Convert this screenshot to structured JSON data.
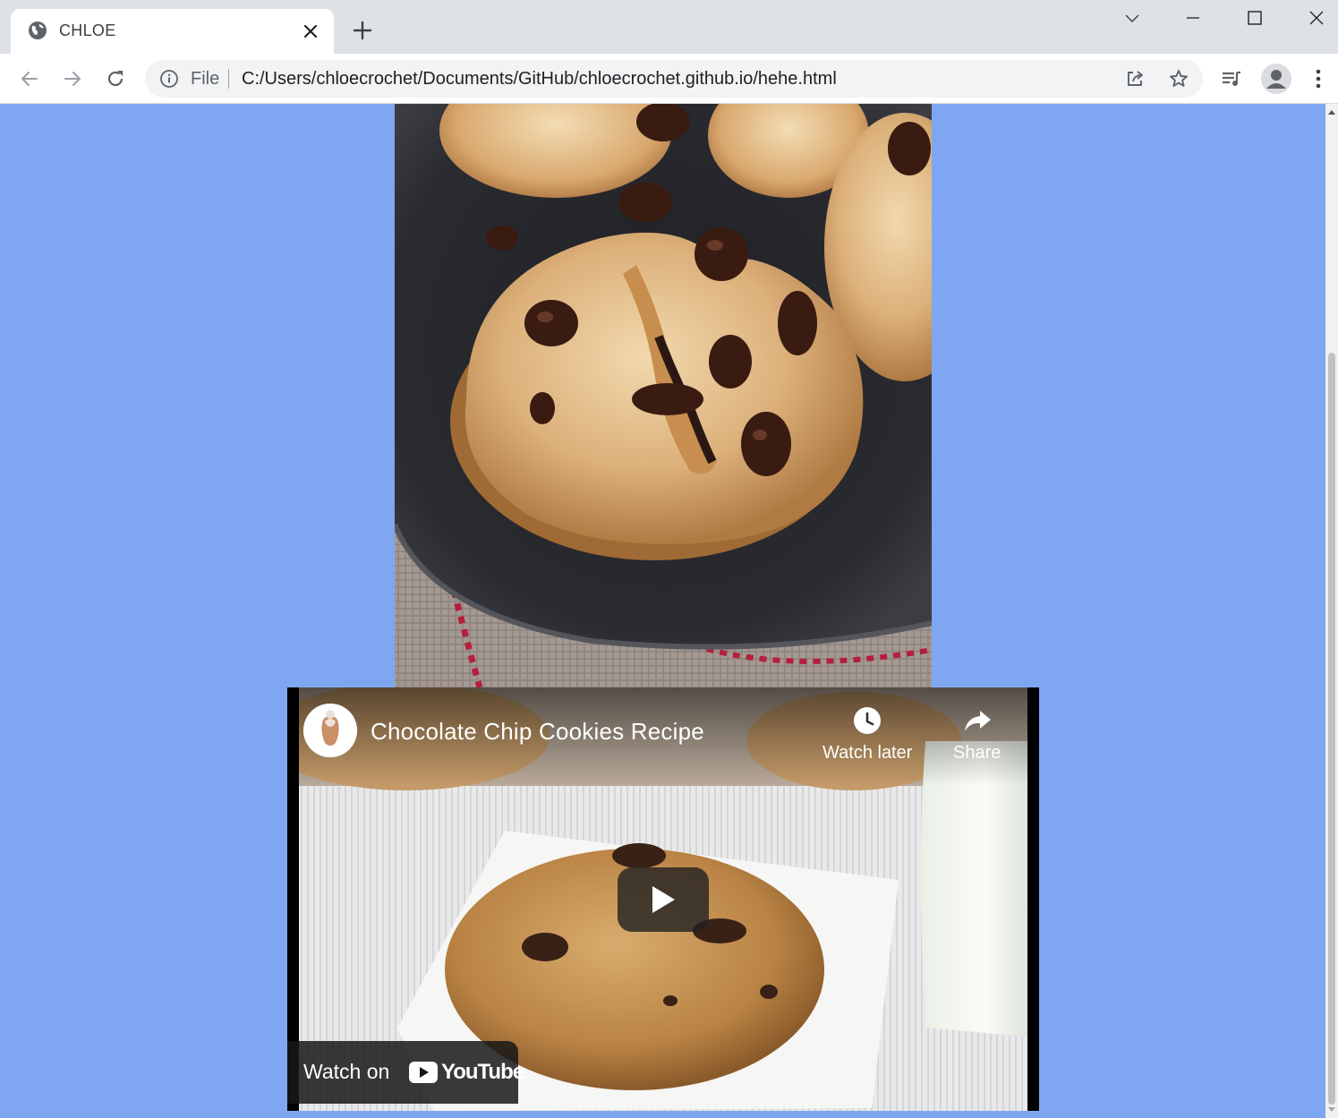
{
  "browser": {
    "tab": {
      "title": "CHLOE",
      "favicon": "globe-icon",
      "close_icon": "close-icon"
    },
    "new_tab_icon": "plus-icon",
    "window_controls": [
      "chevron-down-icon",
      "minimize-icon",
      "maximize-icon",
      "close-window-icon"
    ],
    "nav": {
      "back_icon": "arrow-left-icon",
      "forward_icon": "arrow-right-icon",
      "reload_icon": "reload-icon"
    },
    "omnibox": {
      "info_icon": "info-icon",
      "scheme_label": "File",
      "url": "C:/Users/chloecrochet/Documents/GitHub/chloecrochet.github.io/hehe.html",
      "share_icon": "share-icon",
      "bookmark_icon": "star-icon"
    },
    "toolbar_right": [
      "media-queue-icon",
      "profile-avatar-icon",
      "kebab-menu-icon"
    ]
  },
  "page": {
    "background_color": "#7fa7f1",
    "image": {
      "subject": "chocolate-chip-cookies-photo"
    },
    "video": {
      "title": "Chocolate Chip Cookies Recipe",
      "actions": [
        {
          "label": "Watch later",
          "icon": "clock-icon"
        },
        {
          "label": "Share",
          "icon": "share-arrow-icon"
        }
      ],
      "watch_on_label": "Watch on",
      "brand": "YouTube",
      "play_icon": "play-icon"
    }
  }
}
